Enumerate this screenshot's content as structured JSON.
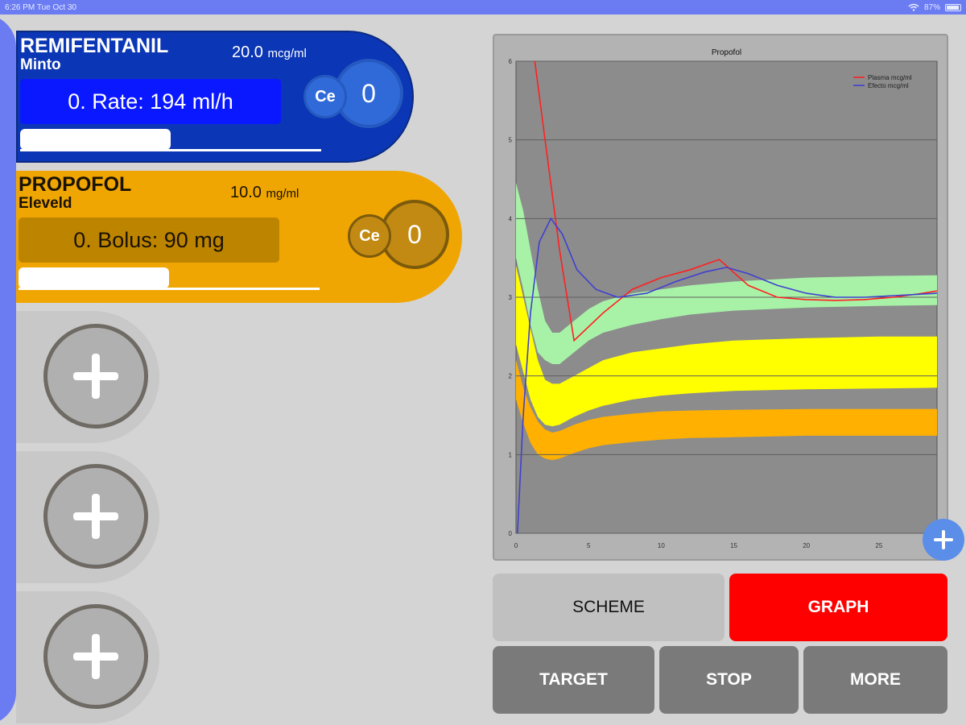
{
  "status_bar": {
    "time": "6:26 PM   Tue Oct 30",
    "battery": "87%"
  },
  "drugs": [
    {
      "name": "REMIFENTANIL",
      "model": "Minto",
      "concentration": "20.0",
      "concentration_unit": "mcg/ml",
      "action": "0. Rate: 194 ml/h",
      "ce_label": "Ce",
      "ce_value": "0",
      "progress_fraction": 0.5,
      "color": "#0b36b5"
    },
    {
      "name": "PROPOFOL",
      "model": "Eleveld",
      "concentration": "10.0",
      "concentration_unit": "mg/ml",
      "action": "0. Bolus: 90 mg",
      "ce_label": "Ce",
      "ce_value": "0",
      "progress_fraction": 0.5,
      "color": "#f0a602"
    }
  ],
  "empty_slots": [
    {
      "icon": "plus-icon"
    },
    {
      "icon": "plus-icon"
    },
    {
      "icon": "plus-icon"
    }
  ],
  "buttons": {
    "scheme": "SCHEME",
    "graph": "GRAPH",
    "target": "TARGET",
    "stop": "STOP",
    "more": "MORE"
  },
  "chart_data": {
    "type": "line",
    "title": "Propofol",
    "xlabel": "",
    "ylabel": "",
    "xlim": [
      0,
      29
    ],
    "ylim": [
      0,
      6
    ],
    "xticks": [
      0,
      5,
      10,
      15,
      20,
      25
    ],
    "yticks": [
      0,
      1,
      2,
      3,
      4,
      5,
      6
    ],
    "grid": true,
    "legend_position": "top-right",
    "series": [
      {
        "name": "Plasma mcg/ml",
        "color": "#ff2020",
        "points": [
          [
            1.3,
            6.0
          ],
          [
            2.0,
            5.0
          ],
          [
            3.0,
            3.6
          ],
          [
            4.0,
            2.45
          ],
          [
            6.0,
            2.8
          ],
          [
            8.0,
            3.1
          ],
          [
            10.0,
            3.25
          ],
          [
            12.0,
            3.35
          ],
          [
            14.0,
            3.48
          ],
          [
            16.0,
            3.15
          ],
          [
            18.0,
            3.0
          ],
          [
            20.0,
            2.97
          ],
          [
            22.0,
            2.96
          ],
          [
            24.0,
            2.97
          ],
          [
            26.0,
            3.0
          ],
          [
            28.0,
            3.05
          ],
          [
            29.0,
            3.08
          ]
        ]
      },
      {
        "name": "Efecto mcg/ml",
        "color": "#4040d0",
        "points": [
          [
            0.1,
            0.0
          ],
          [
            0.5,
            1.5
          ],
          [
            1.0,
            2.8
          ],
          [
            1.6,
            3.7
          ],
          [
            2.4,
            4.0
          ],
          [
            3.2,
            3.8
          ],
          [
            4.2,
            3.35
          ],
          [
            5.5,
            3.1
          ],
          [
            7.0,
            3.0
          ],
          [
            9.0,
            3.05
          ],
          [
            11.0,
            3.2
          ],
          [
            13.0,
            3.32
          ],
          [
            14.5,
            3.38
          ],
          [
            16.0,
            3.3
          ],
          [
            18.0,
            3.15
          ],
          [
            20.0,
            3.05
          ],
          [
            22.0,
            3.0
          ],
          [
            24.0,
            3.0
          ],
          [
            26.0,
            3.02
          ],
          [
            29.0,
            3.05
          ]
        ]
      }
    ],
    "bands": [
      {
        "color": "#a8f2a8",
        "x": [
          0,
          0.5,
          1.0,
          1.5,
          2.0,
          2.5,
          3,
          4,
          5,
          6,
          8,
          10,
          12,
          15,
          20,
          25,
          29
        ],
        "upper": [
          4.45,
          4.1,
          3.6,
          3.1,
          2.7,
          2.55,
          2.55,
          2.7,
          2.85,
          2.95,
          3.05,
          3.1,
          3.15,
          3.2,
          3.25,
          3.27,
          3.28
        ],
        "lower": [
          3.5,
          3.1,
          2.65,
          2.3,
          2.2,
          2.15,
          2.15,
          2.3,
          2.45,
          2.55,
          2.65,
          2.72,
          2.78,
          2.83,
          2.87,
          2.89,
          2.9
        ]
      },
      {
        "color": "#ffff00",
        "x": [
          0,
          0.5,
          1.0,
          1.5,
          2.0,
          2.5,
          3,
          4,
          5,
          6,
          8,
          10,
          12,
          15,
          20,
          25,
          29
        ],
        "upper": [
          3.4,
          3.0,
          2.6,
          2.2,
          1.95,
          1.9,
          1.9,
          2.0,
          2.1,
          2.2,
          2.3,
          2.35,
          2.4,
          2.45,
          2.48,
          2.5,
          2.5
        ],
        "lower": [
          2.4,
          2.05,
          1.7,
          1.48,
          1.38,
          1.36,
          1.38,
          1.48,
          1.56,
          1.62,
          1.7,
          1.75,
          1.78,
          1.81,
          1.83,
          1.84,
          1.85
        ]
      },
      {
        "color": "#ffb000",
        "x": [
          0,
          0.5,
          1.0,
          1.5,
          2.0,
          2.5,
          3,
          4,
          5,
          6,
          8,
          10,
          12,
          15,
          20,
          25,
          29
        ],
        "upper": [
          2.2,
          1.85,
          1.6,
          1.42,
          1.32,
          1.28,
          1.3,
          1.38,
          1.44,
          1.48,
          1.52,
          1.55,
          1.56,
          1.57,
          1.58,
          1.58,
          1.58
        ],
        "lower": [
          1.7,
          1.4,
          1.15,
          1.0,
          0.95,
          0.93,
          0.95,
          1.02,
          1.08,
          1.12,
          1.16,
          1.19,
          1.21,
          1.22,
          1.24,
          1.24,
          1.24
        ]
      }
    ]
  }
}
